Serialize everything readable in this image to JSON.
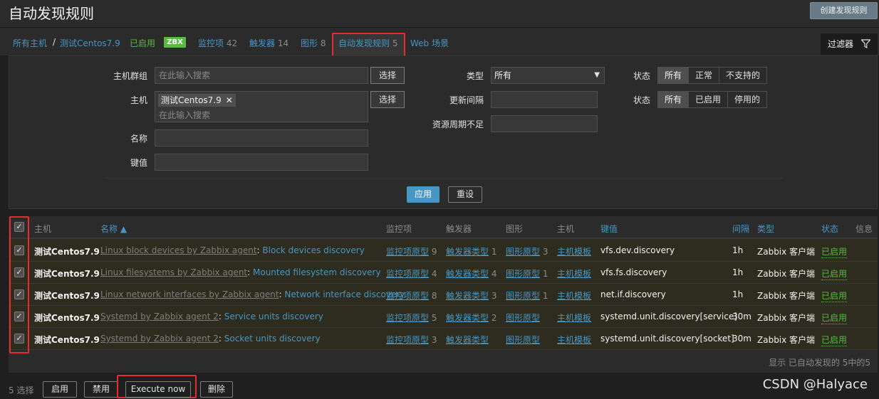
{
  "header": {
    "title": "自动发现规则",
    "create_button": "创建发现规则"
  },
  "nav": {
    "all_hosts": "所有主机",
    "separator": "/",
    "host": "测试Centos7.9",
    "enabled": "已启用",
    "zbx": "ZBX",
    "items_label": "监控项",
    "items_count": "42",
    "triggers_label": "触发器",
    "triggers_count": "14",
    "graphs_label": "图形",
    "graphs_count": "8",
    "discovery_label": "自动发现规则",
    "discovery_count": "5",
    "web_label": "Web 场景",
    "filter_tab": "过滤器"
  },
  "filter": {
    "hostgroup_label": "主机群组",
    "hostgroup_placeholder": "在此输入搜索",
    "select_button": "选择",
    "host_label": "主机",
    "host_chip": "测试Centos7.9",
    "host_chip_remove": "✕",
    "host_placeholder": "在此输入搜索",
    "name_label": "名称",
    "key_label": "键值",
    "type_label": "类型",
    "type_value": "所有",
    "update_label": "更新间隔",
    "lld_label": "资源周期不足",
    "state_label": "状态",
    "state_options": [
      "所有",
      "正常",
      "不支持的"
    ],
    "status_label": "状态",
    "status_options": [
      "所有",
      "已启用",
      "停用的"
    ],
    "apply": "应用",
    "reset": "重设"
  },
  "table": {
    "headers": {
      "host": "主机",
      "name": "名称 ▲",
      "items": "监控项",
      "triggers": "触发器",
      "graphs": "图形",
      "hosts": "主机",
      "key": "键值",
      "interval": "间隔",
      "type": "类型",
      "status": "状态",
      "info": "信息"
    },
    "rows": [
      {
        "host": "测试Centos7.9",
        "template": "Linux block devices by Zabbix agent",
        "name": "Block devices discovery",
        "items": "监控项原型",
        "items_count": "9",
        "triggers": "触发器类型",
        "triggers_count": "1",
        "graphs": "图形原型",
        "graphs_count": "3",
        "hosts": "主机模板",
        "key": "vfs.dev.discovery",
        "interval": "1h",
        "type": "Zabbix 客户端",
        "status": "已启用"
      },
      {
        "host": "测试Centos7.9",
        "template": "Linux filesystems by Zabbix agent",
        "name": "Mounted filesystem discovery",
        "items": "监控项原型",
        "items_count": "4",
        "triggers": "触发器类型",
        "triggers_count": "4",
        "graphs": "图形原型",
        "graphs_count": "1",
        "hosts": "主机模板",
        "key": "vfs.fs.discovery",
        "interval": "1h",
        "type": "Zabbix 客户端",
        "status": "已启用"
      },
      {
        "host": "测试Centos7.9",
        "template": "Linux network interfaces by Zabbix agent",
        "name": "Network interface discovery",
        "items": "监控项原型",
        "items_count": "8",
        "triggers": "触发器类型",
        "triggers_count": "3",
        "graphs": "图形原型",
        "graphs_count": "1",
        "hosts": "主机模板",
        "key": "net.if.discovery",
        "interval": "1h",
        "type": "Zabbix 客户端",
        "status": "已启用"
      },
      {
        "host": "测试Centos7.9",
        "template": "Systemd by Zabbix agent 2",
        "name": "Service units discovery",
        "items": "监控项原型",
        "items_count": "5",
        "triggers": "触发器类型",
        "triggers_count": "2",
        "graphs": "图形原型",
        "graphs_count": "",
        "hosts": "主机模板",
        "key": "systemd.unit.discovery[service]",
        "interval": "30m",
        "type": "Zabbix 客户端",
        "status": "已启用"
      },
      {
        "host": "测试Centos7.9",
        "template": "Systemd by Zabbix agent 2",
        "name": "Socket units discovery",
        "items": "监控项原型",
        "items_count": "3",
        "triggers": "触发器类型",
        "triggers_count": "",
        "graphs": "图形原型",
        "graphs_count": "",
        "hosts": "主机模板",
        "key": "systemd.unit.discovery[socket]",
        "interval": "30m",
        "type": "Zabbix 客户端",
        "status": "已启用"
      }
    ],
    "footer": "显示 已自动发现的 5中的5"
  },
  "bottom": {
    "selected": "5 选择",
    "enable": "启用",
    "disable": "禁用",
    "execute": "Execute now",
    "delete": "删除",
    "watermark": "CSDN @Halyace"
  },
  "colors": {
    "accent": "#4796c4",
    "enabled": "#59b941",
    "highlight_frame": "#e32e2e"
  }
}
